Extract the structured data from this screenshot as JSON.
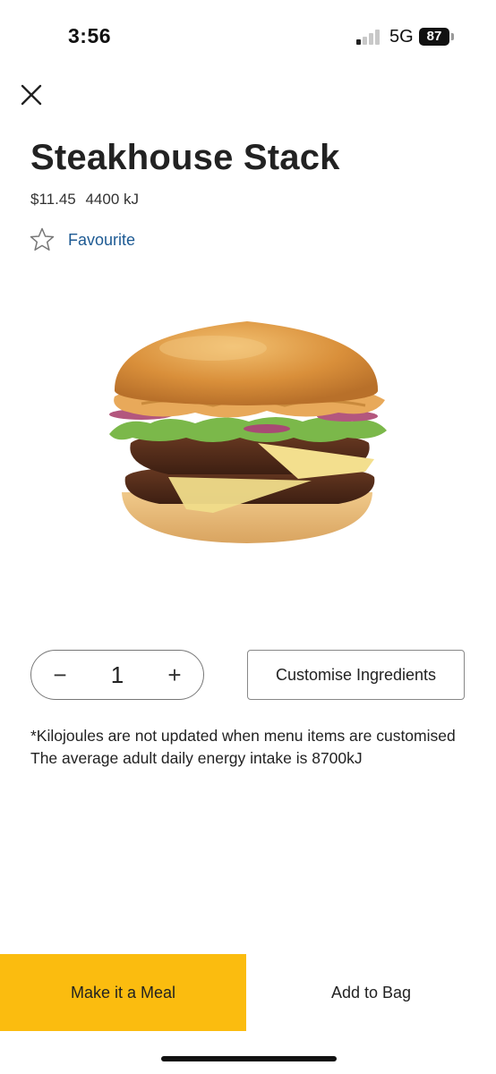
{
  "status_bar": {
    "time": "3:56",
    "network": "5G",
    "battery": "87",
    "signal_bars_active": 1,
    "signal_bars_total": 4
  },
  "product": {
    "title": "Steakhouse Stack",
    "price": "$11.45",
    "energy": "4400 kJ",
    "favourite_label": "Favourite",
    "image_icon": "burger-image"
  },
  "quantity": {
    "minus_label": "−",
    "value": "1",
    "plus_label": "+"
  },
  "customise_label": "Customise Ingredients",
  "note": {
    "line1": "*Kilojoules are not updated when menu items are customised",
    "line2": "The average adult daily energy intake is 8700kJ"
  },
  "actions": {
    "meal_label": "Make it a Meal",
    "bag_label": "Add to Bag"
  },
  "colors": {
    "accent_yellow": "#fbbc0f",
    "link_blue": "#1d5a93"
  }
}
